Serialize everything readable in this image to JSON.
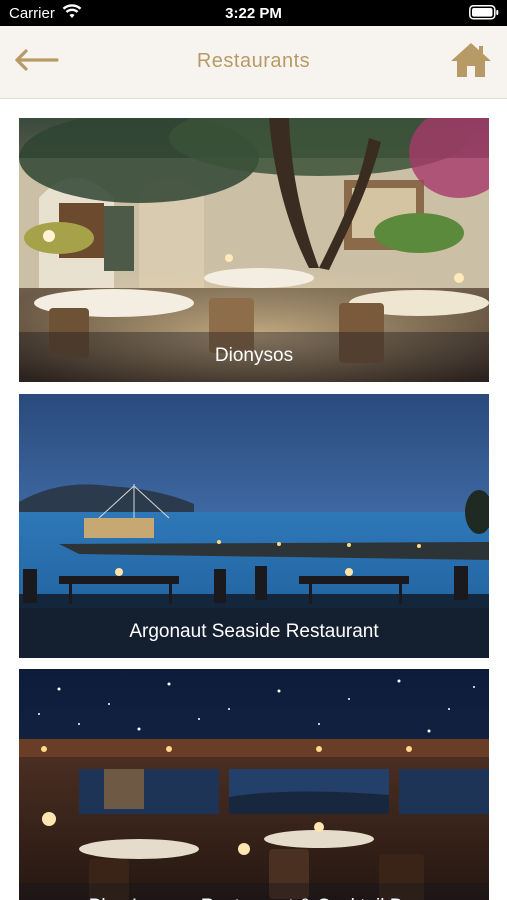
{
  "status_bar": {
    "carrier": "Carrier",
    "time": "3:22 PM"
  },
  "nav": {
    "title": "Restaurants",
    "back_icon": "arrow-left-icon",
    "home_icon": "home-icon",
    "accent_color": "#b89a66"
  },
  "restaurants": [
    {
      "name": "Dionysos"
    },
    {
      "name": "Argonaut Seaside Restaurant"
    },
    {
      "name": "Blue Lagoon Restaurant & Cocktail Bar"
    }
  ]
}
